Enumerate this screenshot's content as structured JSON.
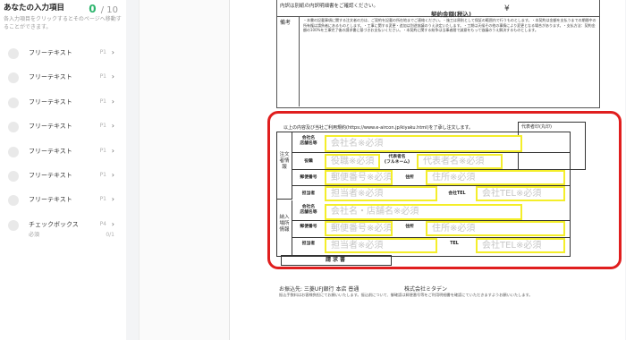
{
  "sidebar": {
    "title": "あなたの入力項目",
    "done_count": "0",
    "total": "/ 10",
    "description": "各入力項目をクリックするとそのページへ移動することができます。",
    "items": [
      {
        "label": "フリーテキスト",
        "page": "P1",
        "chevron": "›"
      },
      {
        "label": "フリーテキスト",
        "page": "P1",
        "chevron": "›"
      },
      {
        "label": "フリーテキスト",
        "page": "P1",
        "chevron": "›"
      },
      {
        "label": "フリーテキスト",
        "page": "P1",
        "chevron": "›"
      },
      {
        "label": "フリーテキスト",
        "page": "P1",
        "chevron": "›"
      },
      {
        "label": "フリーテキスト",
        "page": "P1",
        "chevron": "›"
      },
      {
        "label": "フリーテキスト",
        "page": "P1",
        "chevron": "›"
      }
    ],
    "checkbox_item": {
      "label": "チェックボックス",
      "page": "P4",
      "chevron": "›",
      "sub": "必須",
      "sub_count": "0/1"
    }
  },
  "doc": {
    "top_note": "内訳は別紙の内訳明細書をご確認ください。",
    "amount_label": "契約金額(税込)",
    "yen": "¥",
    "remarks_label": "備考",
    "remarks_text": "・本書の記載事項に関する注文者の方は、ご契約を記載の所在地までご連絡ください。・施工は原則として保証の範囲内で行うものとします。・本契約は金額を支払うまでの期間中の所有権は請負者にあるものとします。・工事に関する変更・追加は別途協議のうえ決定いたします。・工期は天候その他の事情により変更となる場合があります。・支払方法：契約金額の100%を工事完了後の請求書に基づきお支払いください。・本契約に関する紛争は当事者間で誠意をもって協議のうえ解決するものとします。",
    "form_note": "以上の内容及び当社ご利用規約(https://www.e-aircon.jp/kiyaku.html)を了承し注文します。",
    "rep_label": "代表者印(丸印)",
    "orderer_side": "注文者情報",
    "delivery_side": "納入場所情報",
    "labels": {
      "company": "会社名\n店舗名等",
      "title": "役職",
      "rep": "代表者名\n(フルネーム)",
      "zip": "郵便番号",
      "address": "住所",
      "person": "担当者",
      "company_tel": "会社TEL",
      "company2": "会社名\n店舗名等",
      "zip2": "郵便番号",
      "address2": "住所",
      "person2": "担当者",
      "tel2": "TEL"
    },
    "fields": {
      "company": "会社名※必須",
      "title": "役職※必須",
      "rep": "代表者名※必須",
      "zip": "郵便番号※必須",
      "address": "住所※必須",
      "person": "担当者※必須",
      "company_tel": "会社TEL※必須",
      "company2": "会社名・店舗名※必須",
      "zip2": "郵便番号※必須",
      "address2": "住所※必須",
      "person2": "担当者※必須",
      "tel2": "会社TEL※必須"
    },
    "invoice": "請求書",
    "bank": "お振込先: 三菱UFJ銀行 本店 普通",
    "company_name": "株式会社ミタデン",
    "fine_print": "振込手数料はお客様負担にてお願いいたします。振込前について、御確認は郵便番号等をご利用明細書を確認にていただきますようお願いいたします。"
  },
  "colors": {
    "highlight": "#e01e1e",
    "field_border": "#f4ee2a",
    "done": "#2db56d"
  }
}
